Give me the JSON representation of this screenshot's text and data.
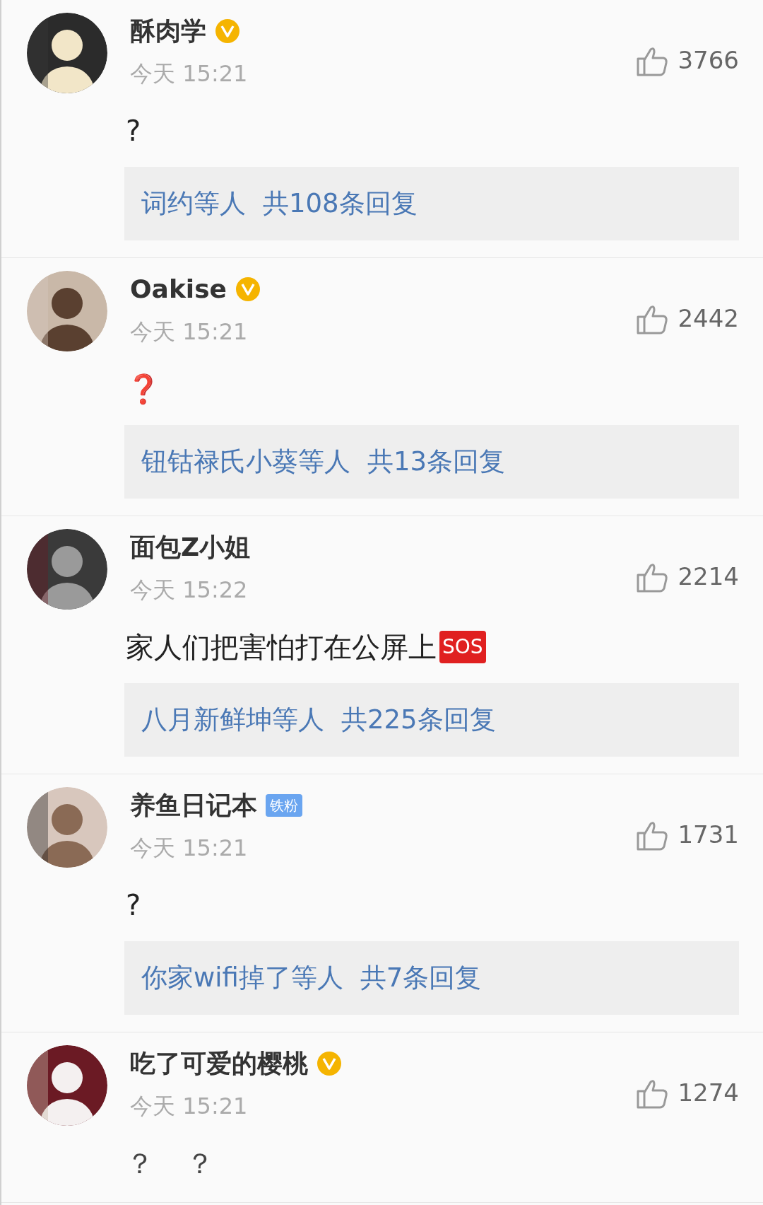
{
  "comments": [
    {
      "name": "酥肉学",
      "badge": {
        "kind": "verified"
      },
      "time": "今天 15:21",
      "likes": "3766",
      "text": "?",
      "kind": "plain",
      "replies": {
        "names": "词约等人",
        "count": "共108条回复"
      }
    },
    {
      "name": "Oakise",
      "badge": {
        "kind": "verified"
      },
      "time": "今天 15:21",
      "likes": "2442",
      "text": "❓",
      "kind": "red",
      "replies": {
        "names": "钮钴禄氏小葵等人",
        "count": "共13条回复"
      }
    },
    {
      "name": "面包Z小姐",
      "time": "今天 15:22",
      "likes": "2214",
      "text": "家人们把害怕打在公屏上",
      "emoji": "SOS",
      "kind": "plain",
      "replies": {
        "names": "八月新鲜坤等人",
        "count": "共225条回复"
      }
    },
    {
      "name": "养鱼日记本",
      "badge": {
        "kind": "fan",
        "label": "铁粉"
      },
      "time": "今天 15:21",
      "likes": "1731",
      "text": "?",
      "kind": "plain",
      "replies": {
        "names": "你家wifi掉了等人",
        "count": "共7条回复"
      }
    },
    {
      "name": "吃了可爱的樱桃",
      "badge": {
        "kind": "verified"
      },
      "time": "今天 15:21",
      "likes": "1274",
      "text": "？ ？",
      "kind": "spaced"
    }
  ]
}
